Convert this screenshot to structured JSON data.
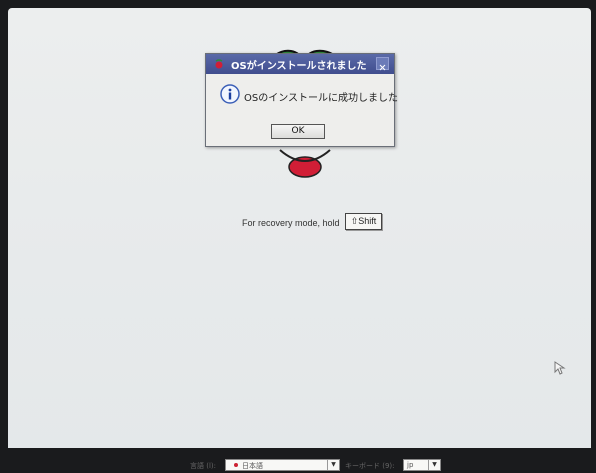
{
  "dialog": {
    "title": "OSがインストールされました",
    "message": "OSのインストールに成功しました",
    "ok_label": "OK"
  },
  "recovery": {
    "text": "For recovery mode, hold",
    "key_label": "⇧Shift"
  },
  "bottombar": {
    "language_label": "言語 (l):",
    "language_value": "日本語",
    "keyboard_label": "キーボード (9):",
    "keyboard_value": "jp"
  },
  "colors": {
    "titlebar": "#404d8e",
    "logo_red": "#d11e36",
    "logo_green": "#2f8a3c"
  },
  "icons": {
    "title": "raspberry-icon",
    "info": "info-icon",
    "close": "close-icon",
    "cursor": "mouse-pointer-icon"
  }
}
